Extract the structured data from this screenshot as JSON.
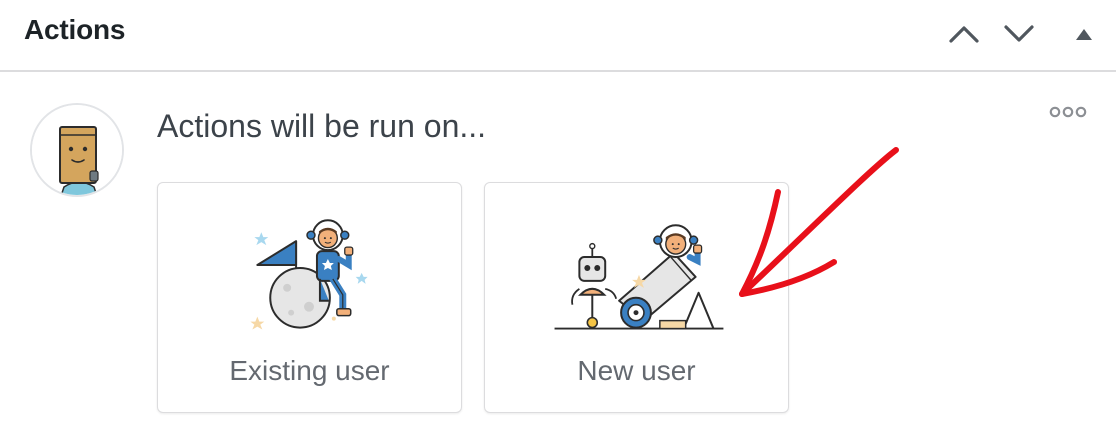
{
  "header": {
    "title": "Actions",
    "controls": [
      "chevron-up-icon",
      "chevron-down-icon",
      "caret-up-icon"
    ]
  },
  "body": {
    "prompt": "Actions will be run on...",
    "options": [
      {
        "label": "Existing user",
        "icon": "astronaut-on-moon-icon"
      },
      {
        "label": "New user",
        "icon": "astronaut-cannon-robot-icon"
      }
    ],
    "more_icon": "more-options-icon"
  },
  "colors": {
    "annotation_arrow": "#e8101a",
    "border": "#dcdcde",
    "label": "#646970",
    "title": "#1d2327"
  }
}
